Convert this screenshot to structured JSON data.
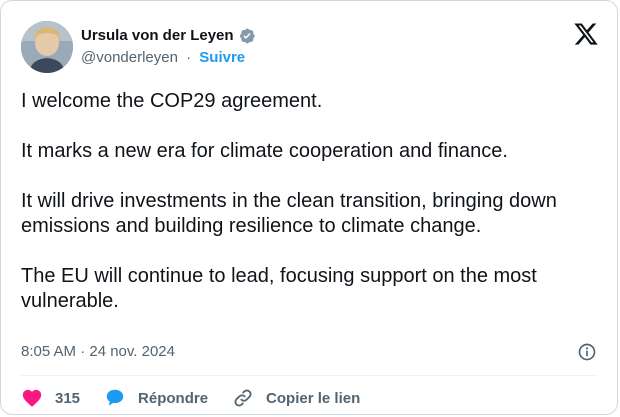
{
  "author": {
    "name": "Ursula von der Leyen",
    "handle": "@vonderleyen",
    "separator": "·",
    "follow_label": "Suivre",
    "avatar_icon": "avatar",
    "verified_icon": "verified-badge-icon",
    "verified_color": "#829aab"
  },
  "platform_logo": "x-logo-icon",
  "tweet": {
    "paragraphs": [
      "I welcome the COP29 agreement.",
      "It marks a new era for climate cooperation and finance.",
      "It will drive investments in the clean transition, bringing down emissions and building resilience to climate change.",
      "The EU will continue to lead, focusing support on the most vulnerable."
    ]
  },
  "meta": {
    "timestamp": "8:05 AM · 24 nov. 2024"
  },
  "actions": {
    "like_count": "315",
    "reply_label": "Répondre",
    "copy_link_label": "Copier le lien"
  },
  "colors": {
    "text": "#0f1419",
    "secondary": "#536471",
    "accent": "#1d9bf0",
    "like": "#f91880",
    "border": "#cfd9de"
  }
}
